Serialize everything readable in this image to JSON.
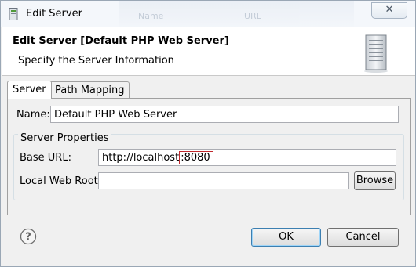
{
  "window": {
    "title": "Edit Server",
    "close_glyph": "✕",
    "background_columns": [
      "Name",
      "URL"
    ]
  },
  "banner": {
    "title": "Edit Server [Default PHP Web Server]",
    "subtitle": "Specify the Server Information",
    "icon": "server-icon"
  },
  "tabs": [
    {
      "label": "Server",
      "active": true
    },
    {
      "label": "Path Mapping",
      "active": false
    }
  ],
  "form": {
    "name_label": "Name:",
    "name_value": "Default PHP Web Server",
    "group_label": "Server Properties",
    "base_url_label": "Base URL:",
    "base_url_prefix": "http://localhost",
    "base_url_port": ":8080",
    "local_root_label": "Local Web Root:",
    "local_root_value": "",
    "browse_label": "Browse"
  },
  "footer": {
    "help_icon": "help-icon",
    "ok_label": "OK",
    "cancel_label": "Cancel"
  },
  "colors": {
    "highlight": "#c0282d",
    "default_button_border": "#3c7fb1"
  }
}
